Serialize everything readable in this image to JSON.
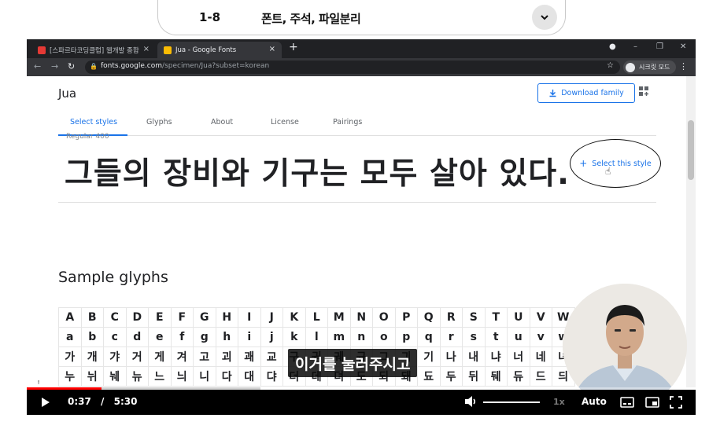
{
  "header": {
    "number": "1-8",
    "title": "폰트, 주석, 파일분리",
    "toggle_icon": "chevron-down-icon"
  },
  "browser": {
    "tabs": [
      {
        "label": "[스파르타코딩클럽] 웹개발 종합",
        "close": "×",
        "icon_color": "#e53935"
      },
      {
        "label": "Jua - Google Fonts",
        "close": "×",
        "icon_color": "#fbbc04"
      }
    ],
    "new_tab": "+",
    "window_controls": {
      "minimize": "–",
      "restore": "❐",
      "close": "✕"
    },
    "url_host": "fonts.google.com",
    "url_path": "/specimen/Jua?subset=korean",
    "profile_label": "시크릿 모드"
  },
  "page": {
    "font_name": "Jua",
    "download_label": "Download family",
    "tabs": [
      "Select styles",
      "Glyphs",
      "About",
      "License",
      "Pairings"
    ],
    "style_label": "Regular 400",
    "sample_text": "그들의 장비와 기구는 모두 살아 있다.",
    "select_style_label": "Select this style",
    "glyphs_title": "Sample glyphs",
    "glyph_rows": [
      [
        "A",
        "B",
        "C",
        "D",
        "E",
        "F",
        "G",
        "H",
        "I",
        "J",
        "K",
        "L",
        "M",
        "N",
        "O",
        "P",
        "Q",
        "R",
        "S",
        "T",
        "U",
        "V",
        "W"
      ],
      [
        "a",
        "b",
        "c",
        "d",
        "e",
        "f",
        "g",
        "h",
        "i",
        "j",
        "k",
        "l",
        "m",
        "n",
        "o",
        "p",
        "q",
        "r",
        "s",
        "t",
        "u",
        "v",
        "w"
      ],
      [
        "가",
        "개",
        "갸",
        "거",
        "게",
        "겨",
        "고",
        "괴",
        "괘",
        "교",
        "구",
        "궈",
        "궤",
        "규",
        "그",
        "긔",
        "기",
        "나",
        "내",
        "냐",
        "너",
        "네",
        "녀"
      ],
      [
        "누",
        "뉘",
        "눼",
        "뉴",
        "느",
        "늬",
        "니",
        "다",
        "대",
        "댜",
        "더",
        "데",
        "뎌",
        "도",
        "되",
        "돼",
        "됴",
        "두",
        "뒤",
        "뒈",
        "듀",
        "드",
        "듸"
      ]
    ]
  },
  "player": {
    "caption": "이거를 눌러주시고",
    "current_time": "0:37",
    "separator": "/",
    "duration": "5:30",
    "speed": "1x",
    "quality": "Auto",
    "progress_fraction": 0.112,
    "buffered_fraction": 0.35
  }
}
